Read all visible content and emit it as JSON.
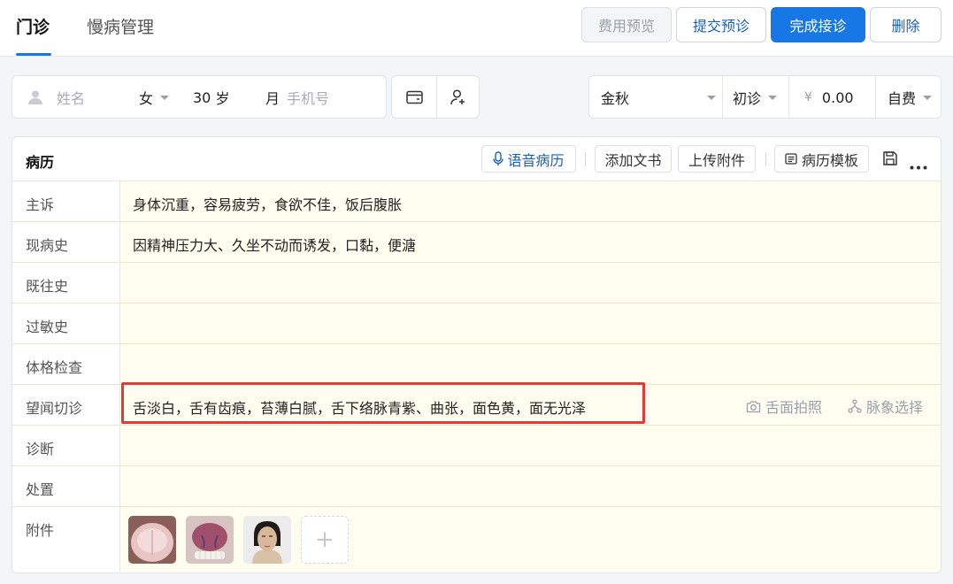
{
  "tabs": [
    {
      "label": "门诊",
      "active": true
    },
    {
      "label": "慢病管理",
      "active": false
    }
  ],
  "toolbar": {
    "fee_preview": "费用预览",
    "submit_precheck": "提交预诊",
    "complete": "完成接诊",
    "delete": "删除"
  },
  "patient": {
    "name_placeholder": "姓名",
    "gender": "女",
    "age_value": "30",
    "age_unit": "岁",
    "month_unit": "月",
    "phone_placeholder": "手机号"
  },
  "visit": {
    "doctor": "金秋",
    "visit_type": "初诊",
    "currency": "¥",
    "fee": "0.00",
    "payment_type": "自费"
  },
  "record": {
    "title": "病历",
    "actions": {
      "voice": "语音病历",
      "add_document": "添加文书",
      "upload_attachment": "上传附件",
      "template": "病历模板"
    },
    "fields": [
      {
        "label": "主诉",
        "value": "身体沉重，容易疲劳，食欲不佳，饭后腹胀"
      },
      {
        "label": "现病史",
        "value": "因精神压力大、久坐不动而诱发，口黏，便溏"
      },
      {
        "label": "既往史",
        "value": ""
      },
      {
        "label": "过敏史",
        "value": ""
      },
      {
        "label": "体格检查",
        "value": ""
      },
      {
        "label": "望闻切诊",
        "value": "舌淡白，舌有齿痕，苔薄白腻，舌下络脉青紫、曲张，面色黄，面无光泽"
      },
      {
        "label": "诊断",
        "value": ""
      },
      {
        "label": "处置",
        "value": ""
      },
      {
        "label": "附件",
        "value": ""
      }
    ],
    "tongue_photo": "舌面拍照",
    "pulse_select": "脉象选择",
    "add_symbol": "+"
  },
  "colors": {
    "primary": "#1677e5",
    "highlight": "#e53935",
    "field_bg": "#fffdf0"
  }
}
